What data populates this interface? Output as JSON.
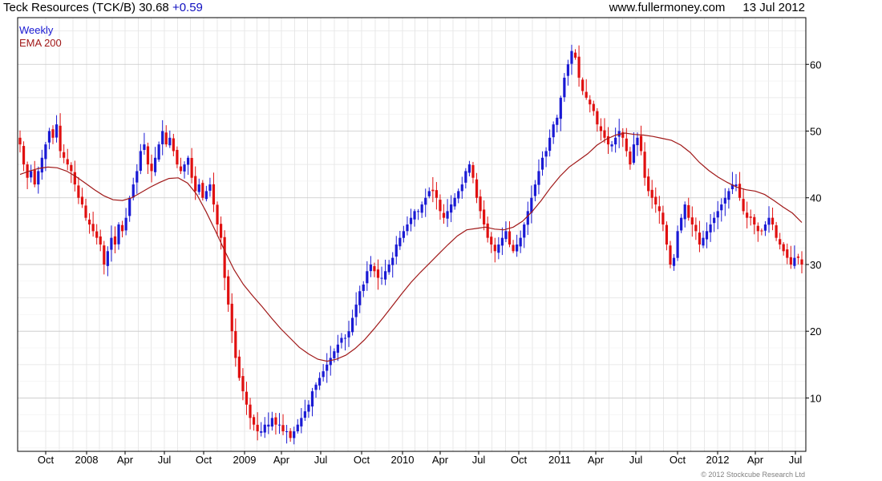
{
  "header": {
    "title": "Teck Resources (TCK/B)",
    "price": "30.68",
    "change": "+0.59",
    "website": "www.fullermoney.com",
    "date": "13 Jul 2012"
  },
  "footer": {
    "copyright": "© 2012 Stockcube Research Ltd"
  },
  "colors": {
    "up": "#1a1ad4",
    "down": "#e01010",
    "ema": "#a01818",
    "grid": "#d8d8d8",
    "legend_weekly": "#1a1ad4",
    "legend_ema": "#a01818"
  },
  "chart_data": {
    "type": "candlestick",
    "period": "Weekly",
    "legend": [
      "Weekly",
      "EMA 200"
    ],
    "x_ticks": [
      "Oct",
      "2008",
      "Apr",
      "Jul",
      "Oct",
      "2009",
      "Apr",
      "Jul",
      "Oct",
      "2010",
      "Apr",
      "Jul",
      "Oct",
      "2011",
      "Apr",
      "Jul",
      "Oct",
      "2012",
      "Apr",
      "Jul"
    ],
    "y_ticks": [
      10,
      20,
      30,
      40,
      50,
      60
    ],
    "ylim": [
      2,
      67
    ],
    "grid": true,
    "y_axis_side": "right",
    "start_date": "2007-07-20",
    "closes": [
      48,
      45,
      43,
      44,
      42,
      44,
      46,
      48,
      50,
      49,
      51,
      47,
      46,
      45,
      44,
      42,
      40,
      39,
      37,
      36,
      35,
      34,
      33,
      30,
      32,
      34,
      33,
      36,
      35,
      37,
      40,
      42,
      44,
      47,
      48,
      45,
      44,
      46,
      48,
      50,
      48,
      49,
      47,
      45,
      44,
      45,
      46,
      43,
      41,
      42,
      40,
      41,
      42,
      39,
      36,
      34,
      28,
      24,
      20,
      16,
      13,
      11,
      9,
      7,
      6,
      5,
      5,
      6,
      6,
      7,
      6,
      6,
      5,
      5,
      4,
      5,
      6,
      7,
      8,
      9,
      11,
      12,
      13,
      14,
      15,
      16,
      17,
      18,
      19,
      19,
      20,
      22,
      24,
      26,
      27,
      29,
      30,
      29,
      28,
      28,
      29,
      30,
      31,
      33,
      34,
      35,
      36,
      37,
      38,
      38,
      39,
      40,
      41,
      41,
      40,
      38,
      37,
      38,
      39,
      40,
      41,
      42,
      44,
      45,
      43,
      40,
      38,
      36,
      34,
      33,
      32,
      33,
      34,
      35,
      33,
      32,
      33,
      34,
      36,
      38,
      40,
      42,
      44,
      46,
      47,
      49,
      51,
      52,
      55,
      58,
      60,
      62,
      61,
      58,
      56,
      55,
      54,
      53,
      51,
      50,
      49,
      48,
      48,
      49,
      50,
      49,
      47,
      45,
      48,
      49,
      47,
      43,
      41,
      40,
      39,
      38,
      36,
      33,
      30,
      31,
      35,
      37,
      39,
      37,
      36,
      35,
      33,
      34,
      35,
      36,
      37,
      38,
      39,
      40,
      41,
      42,
      42,
      40,
      38,
      37,
      37,
      36,
      35,
      35,
      36,
      37,
      36,
      34,
      33,
      32,
      31,
      30,
      31,
      31,
      30
    ],
    "ema_200": [
      43.5,
      44,
      44.4,
      44.6,
      44.5,
      44,
      43.2,
      42.2,
      41.2,
      40.3,
      39.7,
      39.6,
      40,
      40.8,
      41.6,
      42.3,
      42.9,
      43,
      42.2,
      40.5,
      37.9,
      35,
      32,
      29.2,
      27,
      25.3,
      23.7,
      22,
      20.4,
      19,
      17.6,
      16.6,
      15.8,
      15.5,
      15.8,
      16.4,
      17.4,
      18.7,
      20.3,
      22,
      23.8,
      25.6,
      27.3,
      28.8,
      30.2,
      31.6,
      33,
      34.3,
      35.2,
      35.4,
      35.6,
      35.3,
      35.2,
      35.6,
      36.5,
      37.9,
      39.6,
      41.5,
      43.2,
      44.6,
      45.6,
      46.6,
      47.9,
      48.8,
      49.4,
      49.7,
      49.5,
      49.4,
      49.2,
      48.9,
      48.6,
      47.9,
      46.8,
      45.3,
      44.1,
      43.1,
      42.3,
      41.6,
      41.2,
      41,
      40.5,
      39.6,
      38.6,
      37.7,
      36.3
    ]
  }
}
